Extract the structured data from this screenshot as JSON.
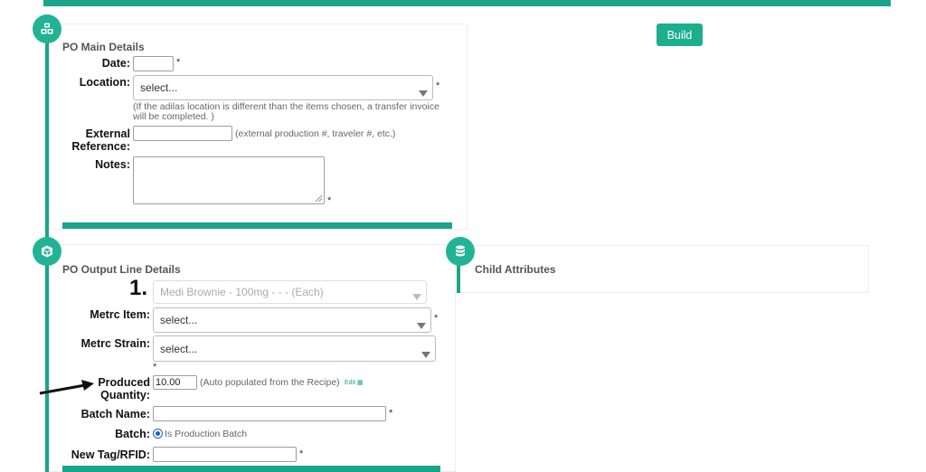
{
  "toolbar": {
    "build_label": "Build"
  },
  "main_details": {
    "title": "PO Main Details",
    "date": {
      "label": "Date:",
      "value": "",
      "required": "*"
    },
    "location": {
      "label": "Location:",
      "value": "select...",
      "required": "*",
      "hint": "(If the adilas location is different than the items chosen, a transfer invoice will be completed. )"
    },
    "external_reference": {
      "label_line1": "External",
      "label_line2": "Reference:",
      "value": "",
      "hint": "(external production #, traveler #, etc.)"
    },
    "notes": {
      "label": "Notes:",
      "value": "",
      "required": "*"
    }
  },
  "output_line": {
    "title": "PO Output Line Details",
    "line_number": "1.",
    "product": {
      "value": "Medi Brownie - 100mg - - - (Each)"
    },
    "metrc_item": {
      "label": "Metrc Item:",
      "value": "select...",
      "required": "*"
    },
    "metrc_strain": {
      "label": "Metrc Strain:",
      "value": "select...",
      "required": "*"
    },
    "produced_quantity": {
      "label_line1": "Produced",
      "label_line2": "Quantity:",
      "value": "10.00",
      "hint": "(Auto populated from the Recipe)",
      "edit_label": "Edit"
    },
    "batch_name": {
      "label": "Batch Name:",
      "value": "",
      "required": "*"
    },
    "batch": {
      "label": "Batch:",
      "option_label": "Is Production Batch",
      "checked": true
    },
    "new_tag": {
      "label": "New Tag/RFID:",
      "value": "",
      "required": "*"
    }
  },
  "child_attributes": {
    "title": "Child Attributes"
  },
  "icons": {
    "main_details": "cubes-icon",
    "output_line": "cube-icon",
    "child_attributes": "database-icon",
    "annotation": "arrow-icon"
  },
  "colors": {
    "accent": "#1aa58a",
    "button": "#1dae8e"
  }
}
